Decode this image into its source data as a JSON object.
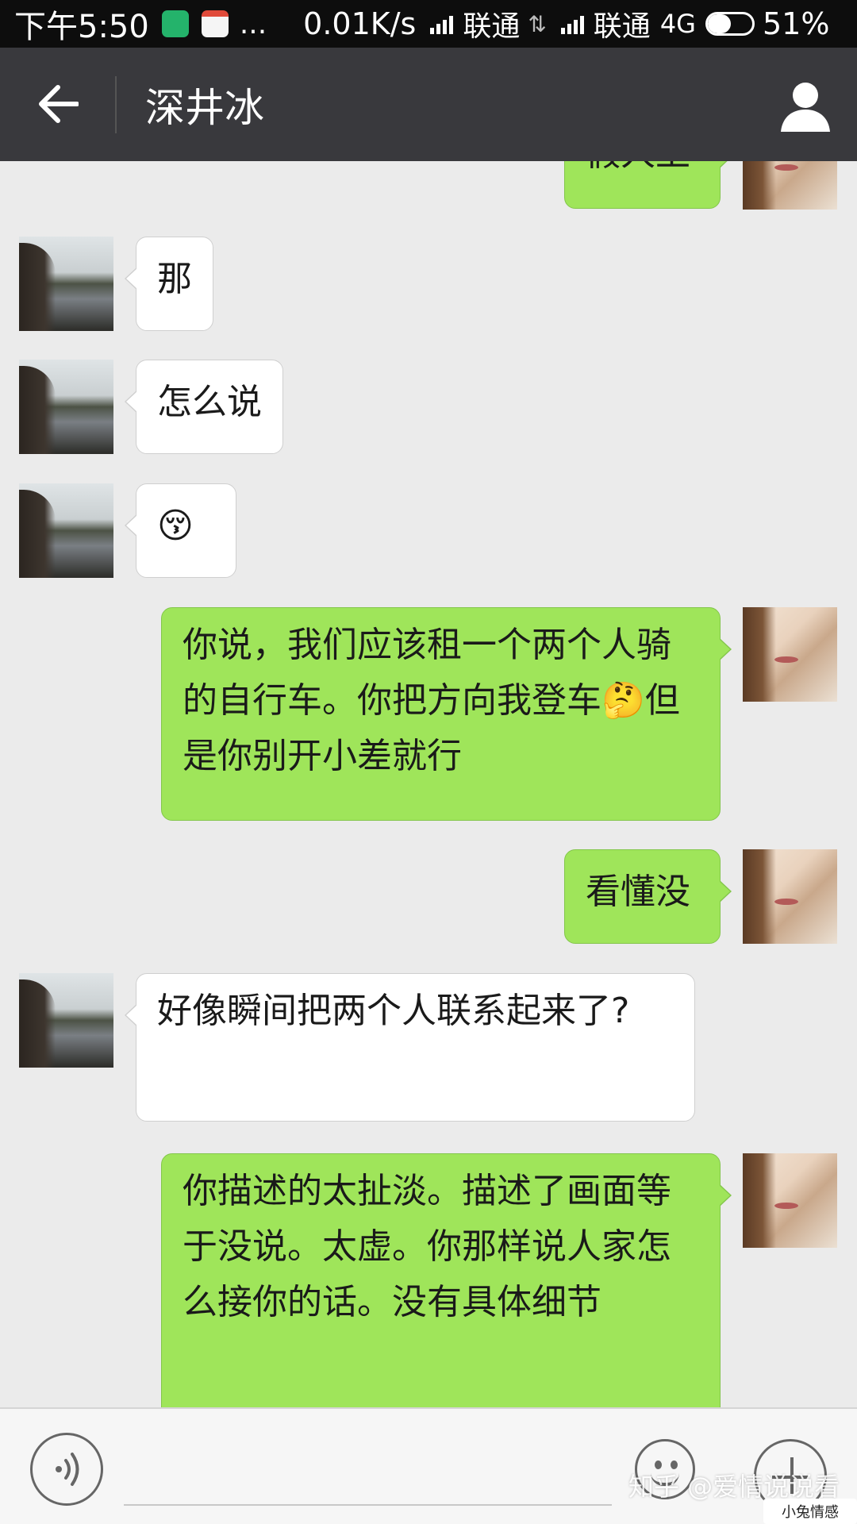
{
  "status_bar": {
    "time": "下午5:50",
    "network_speed": "0.01K/s",
    "carrier_1": "联通",
    "carrier_2": "联通",
    "network_type": "4G",
    "battery_level": 0.51,
    "battery_percent": "51%",
    "more_icons": "..."
  },
  "header": {
    "title": "深井冰",
    "back_icon": "arrow-left-icon",
    "profile_icon": "person-icon"
  },
  "messages": [
    {
      "sender": "me",
      "text": "假人上"
    },
    {
      "sender": "friend",
      "text": "那"
    },
    {
      "sender": "friend",
      "text": "怎么说"
    },
    {
      "sender": "friend",
      "text": "😚"
    },
    {
      "sender": "me",
      "text": "你说，我们应该租一个两个人骑的自行车。你把方向我登车🤔但是你别开小差就行"
    },
    {
      "sender": "me",
      "text": "看懂没"
    },
    {
      "sender": "friend",
      "text": "好像瞬间把两个人联系起来了?"
    },
    {
      "sender": "me",
      "text": "你描述的太扯淡。描述了画面等于没说。太虚。你那样说人家怎么接你的话。没有具体细节"
    }
  ],
  "input_bar": {
    "voice_icon": "voice-icon",
    "emoji_icon": "emoji-icon",
    "plus_icon": "plus-icon"
  },
  "watermark": {
    "text": "知乎 @爱情说说看",
    "logo_text": "小兔情感"
  },
  "colors": {
    "title_bar": "#39393d",
    "chat_background": "#ebebeb",
    "outgoing_bubble": "#9fe55a",
    "incoming_bubble": "#ffffff"
  }
}
